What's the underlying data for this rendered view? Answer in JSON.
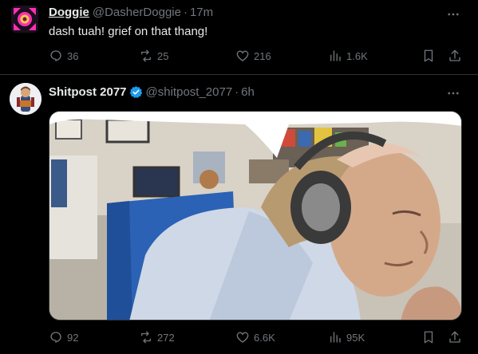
{
  "tweets": [
    {
      "author_name": "Doggie",
      "author_handle": "@DasherDoggie",
      "separator": "·",
      "time": "17m",
      "text": "dash tuah! grief on that thang!",
      "avatar_icon": "pink-square-logo-icon",
      "stats": {
        "replies": "36",
        "reposts": "25",
        "likes": "216",
        "views": "1.6K"
      }
    },
    {
      "author_name": "Shitpost 2077",
      "author_handle": "@shitpost_2077",
      "separator": "·",
      "time": "6h",
      "verified": true,
      "avatar_icon": "cartoon-character-avatar",
      "media": "speech-bubble-streamer-image",
      "stats": {
        "replies": "92",
        "reposts": "272",
        "likes": "6.6K",
        "views": "95K"
      }
    }
  ],
  "colors": {
    "background": "#000000",
    "text": "#e7e9ea",
    "muted": "#71767b",
    "verified": "#1d9bf0",
    "divider": "#2f3336"
  }
}
